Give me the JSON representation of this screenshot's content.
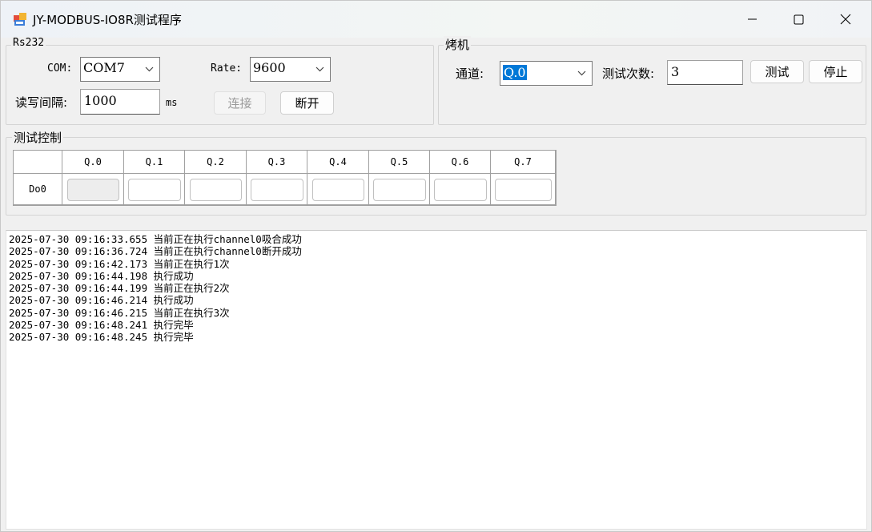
{
  "window": {
    "title": "JY-MODBUS-IO8R测试程序"
  },
  "rs232": {
    "group_title": "Rs232",
    "com_label": "COM:",
    "com_value": "COM7",
    "rate_label": "Rate:",
    "rate_value": "9600",
    "interval_label": "读写间隔:",
    "interval_value": "1000",
    "interval_unit": "ms",
    "connect_label": "连接",
    "disconnect_label": "断开"
  },
  "oven": {
    "group_title": "烤机",
    "channel_label": "通道:",
    "channel_value": "Q.0",
    "count_label": "测试次数:",
    "count_value": "3",
    "test_label": "测试",
    "stop_label": "停止"
  },
  "test_control": {
    "group_title": "测试控制",
    "columns": [
      "Q.0",
      "Q.1",
      "Q.2",
      "Q.3",
      "Q.4",
      "Q.5",
      "Q.6",
      "Q.7"
    ],
    "row_label": "Do0"
  },
  "log": {
    "lines": [
      "2025-07-30 09:16:33.655 当前正在执行channel0吸合成功",
      "2025-07-30 09:16:36.724 当前正在执行channel0断开成功",
      "2025-07-30 09:16:42.173 当前正在执行1次",
      "2025-07-30 09:16:44.198 执行成功",
      "2025-07-30 09:16:44.199 当前正在执行2次",
      "2025-07-30 09:16:46.214 执行成功",
      "2025-07-30 09:16:46.215 当前正在执行3次",
      "2025-07-30 09:16:48.241 执行完毕",
      "2025-07-30 09:16:48.245 执行完毕"
    ]
  },
  "colors": {
    "selection": "#0078d7",
    "window_bg": "#f0f0f0"
  }
}
